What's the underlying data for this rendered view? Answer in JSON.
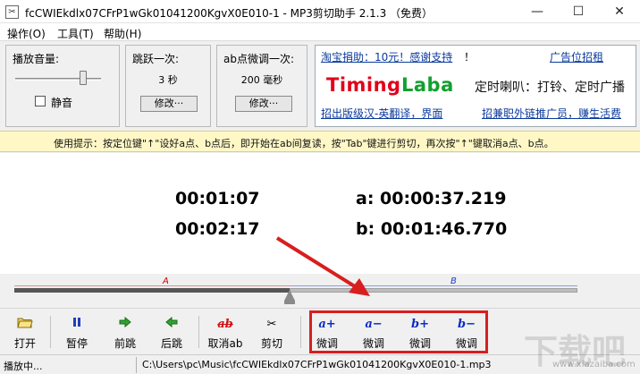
{
  "window": {
    "title": "fcCWIEkdlx07CFrP1wGk01041200KgvX0E010-1 - MP3剪切助手 2.1.3 （免费）",
    "app_icon": "scissors-icon",
    "min": "—",
    "max": "☐",
    "close": "✕"
  },
  "menu": [
    "操作(O)",
    "工具(T)",
    "帮助(H)"
  ],
  "volume_panel": {
    "title": "播放音量:",
    "level": 0.85,
    "mute_label": "静音",
    "muted": false
  },
  "skip_panel": {
    "title": "跳跃一次:",
    "value": "3  秒",
    "button": "修改···"
  },
  "ab_panel": {
    "title": "ab点微调一次:",
    "value": "200  毫秒",
    "button": "修改···"
  },
  "ad": {
    "top_left_link": "淘宝捐助：10元！感谢支持",
    "top_left_tail": "！",
    "top_right_link": "广告位招租",
    "logo_part1": "Timing",
    "logo_part2": "Laba",
    "slogan": "定时喇叭：打铃、定时广播",
    "bottom_left_link": "招出版级汉-英翻译，界面",
    "bottom_right_link": "招兼职外链推广员，赚生活费"
  },
  "hint": "使用提示：按定位键\"↑\"设好a点、b点后，即开始在ab间复读，按\"Tab\"键进行剪切，再次按\"↑\"键取消a点、b点。",
  "times": {
    "current": "00:01:07",
    "total": "00:02:17",
    "a_point": "a: 00:00:37.219",
    "b_point": "b: 00:01:46.770"
  },
  "progress": {
    "a_marker": "A",
    "b_marker": "B",
    "position": 0.49
  },
  "toolbar": {
    "open": "打开",
    "pause": "暂停",
    "prev": "前跳",
    "next": "后跳",
    "cancel_ab": "取消ab",
    "cut": "剪切",
    "a_plus_icon": "a+",
    "a_minus_icon": "a−",
    "b_plus_icon": "b+",
    "b_minus_icon": "b−",
    "cancel_ab_icon": "ab",
    "fine_tune": "微调"
  },
  "status": {
    "left": "播放中...",
    "path": "C:\\Users\\pc\\Music\\fcCWIEkdlx07CFrP1wGk01041200KgvX0E010-1.mp3"
  },
  "watermark": {
    "text": "下载吧",
    "url": "www.xiazaiba.com"
  },
  "colors": {
    "hint_background": "#fff8c6",
    "logo_red": "#e2001a",
    "logo_green": "#12a02f",
    "highlight": "#d81e1e"
  }
}
